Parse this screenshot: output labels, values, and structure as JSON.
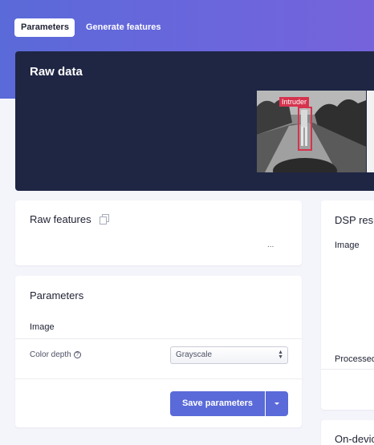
{
  "tabs": [
    {
      "label": "Parameters",
      "active": true
    },
    {
      "label": "Generate features",
      "active": false
    }
  ],
  "raw_data": {
    "title": "Raw data",
    "image_label": "Intruder"
  },
  "raw_features": {
    "title": "Raw features",
    "value": "..."
  },
  "parameters": {
    "title": "Parameters",
    "section": "Image",
    "fields": [
      {
        "label": "Color depth",
        "value": "Grayscale"
      }
    ],
    "save_label": "Save parameters"
  },
  "dsp_result": {
    "title": "DSP resu",
    "image_label": "Image",
    "processed_label": "Processed"
  },
  "on_device": {
    "title": "On-devic"
  },
  "colors": {
    "accent": "#5a6ad8",
    "raw_panel": "#1f2644",
    "label_box": "#d6334e"
  }
}
